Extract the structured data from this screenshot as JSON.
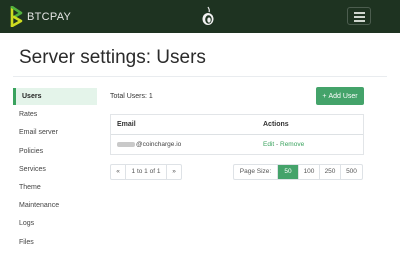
{
  "brand": {
    "name": "BTCPAY"
  },
  "page": {
    "title": "Server settings: Users"
  },
  "sidebar": {
    "items": [
      {
        "label": "Users",
        "active": true
      },
      {
        "label": "Rates",
        "active": false
      },
      {
        "label": "Email server",
        "active": false
      },
      {
        "label": "Policies",
        "active": false
      },
      {
        "label": "Services",
        "active": false
      },
      {
        "label": "Theme",
        "active": false
      },
      {
        "label": "Maintenance",
        "active": false
      },
      {
        "label": "Logs",
        "active": false
      },
      {
        "label": "Files",
        "active": false
      }
    ]
  },
  "users": {
    "total_label": "Total Users: 1",
    "add_button": "Add User",
    "add_icon": "+",
    "columns": {
      "email": "Email",
      "actions": "Actions"
    },
    "rows": [
      {
        "email_domain": "@coincharge.io",
        "edit": "Edit",
        "separator": "-",
        "remove": "Remove"
      }
    ]
  },
  "pager": {
    "prev": "«",
    "info": "1 to 1 of 1",
    "next": "»"
  },
  "page_size": {
    "label": "Page Size:",
    "options": [
      "50",
      "100",
      "250",
      "500"
    ],
    "selected": "50"
  },
  "colors": {
    "navbar": "#1e3321",
    "accent": "#44a36a",
    "active_bg": "#e4f4ea"
  }
}
